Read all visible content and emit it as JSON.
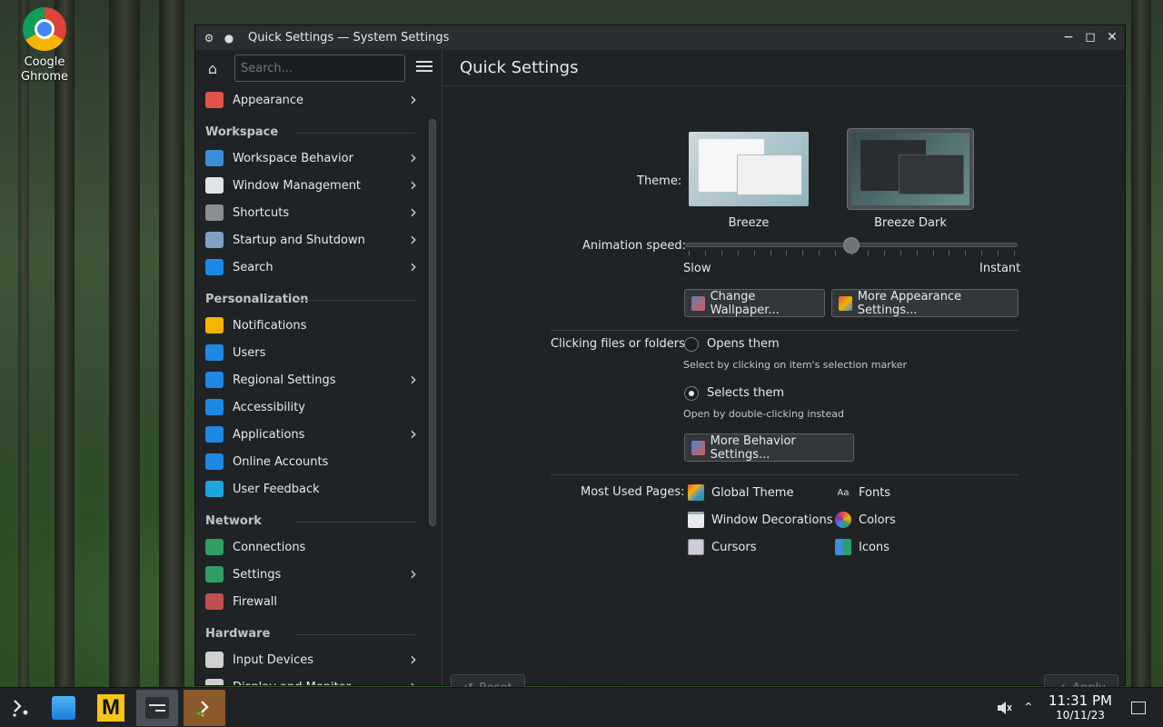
{
  "desktop": {
    "icons": [
      {
        "label_line1": "Coogle",
        "label_line2": "Ghrome",
        "icon": "chrome-icon"
      }
    ]
  },
  "window": {
    "title": "Quick Settings — System Settings",
    "buttons": {
      "minimize": "minimize-icon",
      "maximize": "maximize-icon",
      "close": "close-icon"
    }
  },
  "sidebar": {
    "search_placeholder": "Search...",
    "sections": [
      {
        "title": "",
        "items": [
          {
            "label": "Appearance",
            "chevron": true,
            "color": "#e0534a"
          }
        ]
      },
      {
        "title": "Workspace",
        "items": [
          {
            "label": "Workspace Behavior",
            "chevron": true,
            "color": "#3d8ed9"
          },
          {
            "label": "Window Management",
            "chevron": true,
            "color": "#dfe3e8"
          },
          {
            "label": "Shortcuts",
            "chevron": true,
            "color": "#8a8f94"
          },
          {
            "label": "Startup and Shutdown",
            "chevron": true,
            "color": "#7fa2c4"
          },
          {
            "label": "Search",
            "chevron": true,
            "color": "#1e88e5"
          }
        ]
      },
      {
        "title": "Personalization",
        "items": [
          {
            "label": "Notifications",
            "chevron": false,
            "color": "#f5b400"
          },
          {
            "label": "Users",
            "chevron": false,
            "color": "#1e88e5"
          },
          {
            "label": "Regional Settings",
            "chevron": true,
            "color": "#1e88e5"
          },
          {
            "label": "Accessibility",
            "chevron": false,
            "color": "#1e88e5"
          },
          {
            "label": "Applications",
            "chevron": true,
            "color": "#1e88e5"
          },
          {
            "label": "Online Accounts",
            "chevron": false,
            "color": "#1e88e5"
          },
          {
            "label": "User Feedback",
            "chevron": false,
            "color": "#1ea5e0"
          }
        ]
      },
      {
        "title": "Network",
        "items": [
          {
            "label": "Connections",
            "chevron": false,
            "color": "#2f9e63"
          },
          {
            "label": "Settings",
            "chevron": true,
            "color": "#2f9e63"
          },
          {
            "label": "Firewall",
            "chevron": false,
            "color": "#c0504d"
          }
        ]
      },
      {
        "title": "Hardware",
        "items": [
          {
            "label": "Input Devices",
            "chevron": true,
            "color": "#d0d0d0"
          },
          {
            "label": "Display and Monitor",
            "chevron": true,
            "color": "#d0d0d0"
          }
        ]
      }
    ]
  },
  "main": {
    "title": "Quick Settings",
    "theme": {
      "label": "Theme:",
      "options": [
        {
          "name": "Breeze",
          "selected": false
        },
        {
          "name": "Breeze Dark",
          "selected": true
        }
      ]
    },
    "animation": {
      "label": "Animation speed:",
      "min_label": "Slow",
      "max_label": "Instant",
      "value": 0.5
    },
    "buttons": {
      "change_wallpaper": "Change Wallpaper...",
      "more_appearance": "More Appearance Settings...",
      "more_behavior": "More Behavior Settings...",
      "reset": "Reset",
      "apply": "Apply"
    },
    "clicking": {
      "label": "Clicking files or folders:",
      "options": [
        {
          "label": "Opens them",
          "hint": "Select by clicking on item's selection marker",
          "selected": false
        },
        {
          "label": "Selects them",
          "hint": "Open by double-clicking instead",
          "selected": true
        }
      ]
    },
    "most_used": {
      "label": "Most Used Pages:",
      "col1": [
        {
          "label": "Global Theme",
          "icon": "global-theme-icon"
        },
        {
          "label": "Window Decorations",
          "icon": "window-decorations-icon"
        },
        {
          "label": "Cursors",
          "icon": "cursors-icon"
        }
      ],
      "col2": [
        {
          "label": "Fonts",
          "icon": "fonts-icon",
          "glyph": "Aa"
        },
        {
          "label": "Colors",
          "icon": "colors-icon"
        },
        {
          "label": "Icons",
          "icon": "icons-icon"
        }
      ]
    }
  },
  "taskbar": {
    "apps": [
      "application-launcher-icon",
      "discover-store-icon",
      "m-app-icon",
      "system-settings-icon",
      "task-app-icon"
    ],
    "clock_time": "11:31 PM",
    "clock_date": "10/11/23"
  }
}
